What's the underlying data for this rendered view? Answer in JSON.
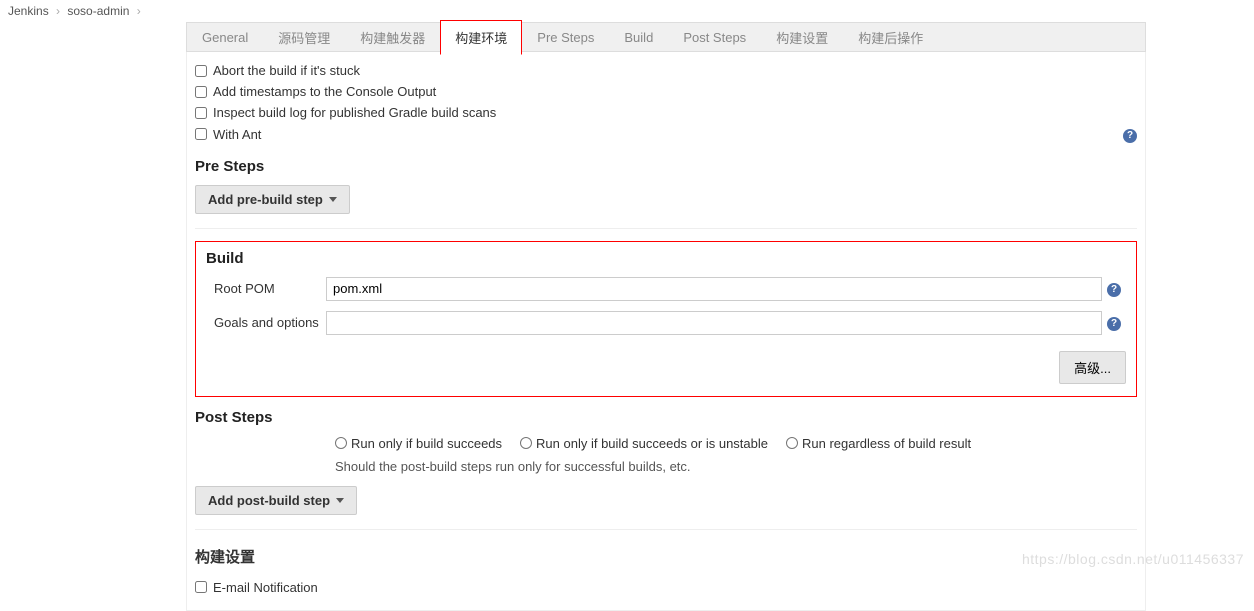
{
  "breadcrumb": {
    "root": "Jenkins",
    "project": "soso-admin"
  },
  "tabs": {
    "general": "General",
    "scm": "源码管理",
    "triggers": "构建触发器",
    "env": "构建环境",
    "presteps": "Pre Steps",
    "build": "Build",
    "poststeps": "Post Steps",
    "buildsettings": "构建设置",
    "postbuild": "构建后操作"
  },
  "env_checks": {
    "abort": "Abort the build if it's stuck",
    "timestamps": "Add timestamps to the Console Output",
    "gradle": "Inspect build log for published Gradle build scans",
    "withant": "With Ant"
  },
  "sections": {
    "presteps_title": "Pre Steps",
    "build_title": "Build",
    "poststeps_title": "Post Steps",
    "buildsettings_title": "构建设置"
  },
  "buttons": {
    "add_pre": "Add pre-build step",
    "advanced": "高级...",
    "add_post": "Add post-build step"
  },
  "build_form": {
    "root_pom_label": "Root POM",
    "root_pom_value": "pom.xml",
    "goals_label": "Goals and options",
    "goals_value": ""
  },
  "poststeps": {
    "radio1": "Run only if build succeeds",
    "radio2": "Run only if build succeeds or is unstable",
    "radio3": "Run regardless of build result",
    "hint": "Should the post-build steps run only for successful builds, etc."
  },
  "buildsettings": {
    "email": "E-mail Notification"
  },
  "watermark": "https://blog.csdn.net/u011456337"
}
